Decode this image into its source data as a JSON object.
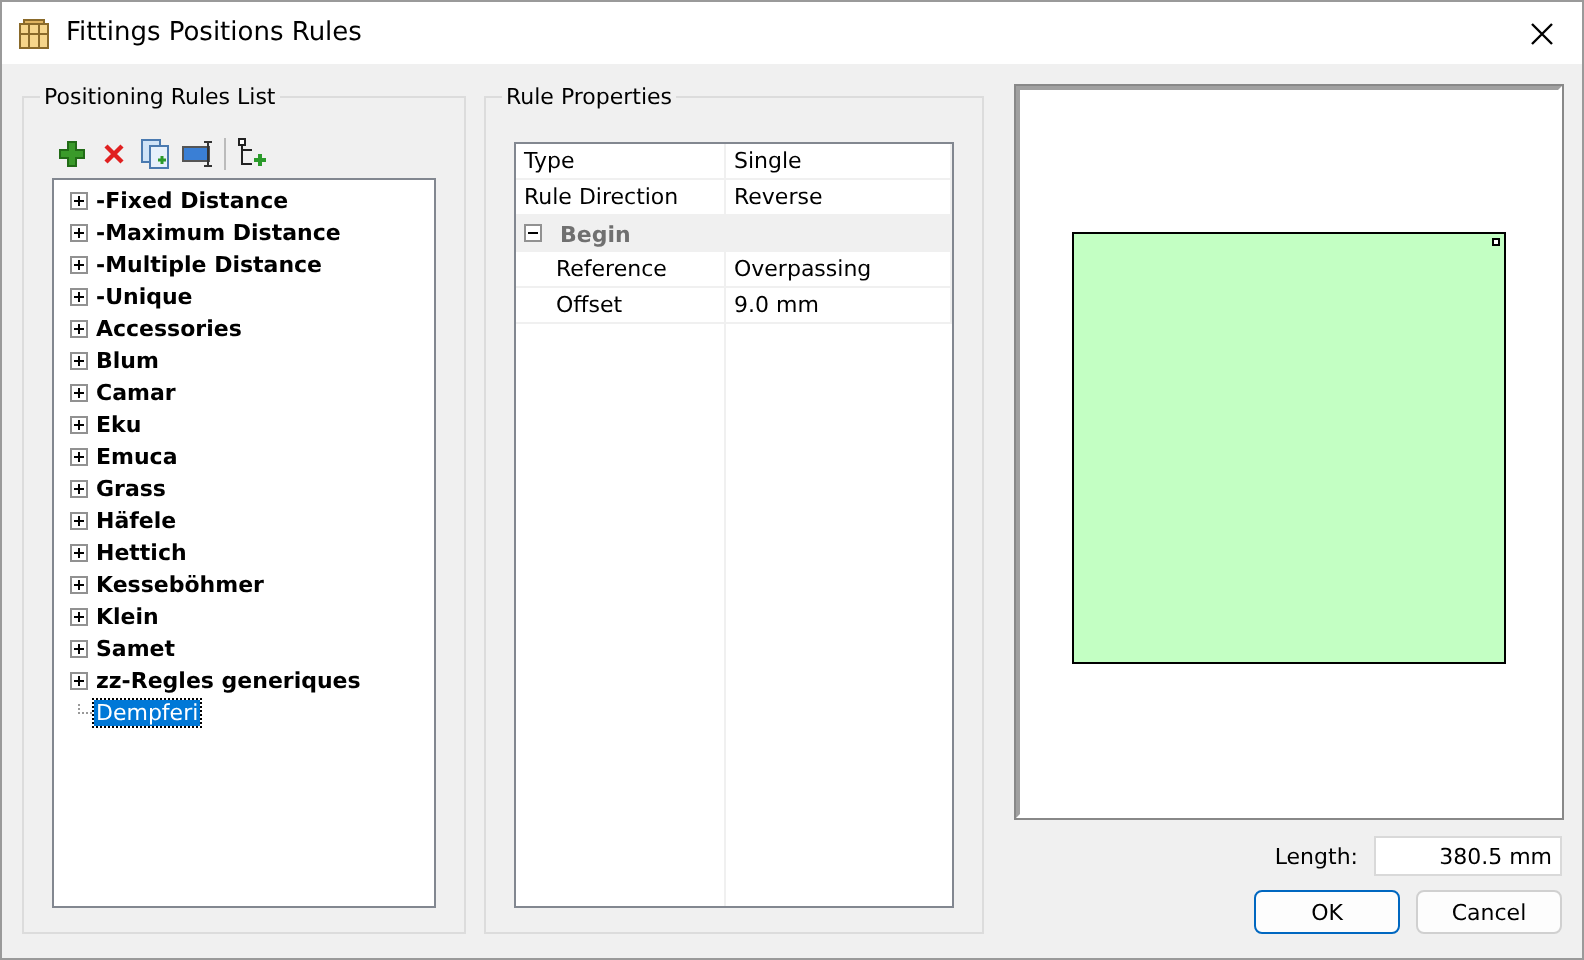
{
  "window": {
    "title": "Fittings Positions Rules"
  },
  "rules_list": {
    "title": "Positioning Rules List",
    "items": [
      {
        "label": "-Fixed Distance",
        "kind": "group",
        "selected": false
      },
      {
        "label": "-Maximum Distance",
        "kind": "group",
        "selected": false
      },
      {
        "label": "-Multiple Distance",
        "kind": "group",
        "selected": false
      },
      {
        "label": "-Unique",
        "kind": "group",
        "selected": false
      },
      {
        "label": "Accessories",
        "kind": "group",
        "selected": false
      },
      {
        "label": "Blum",
        "kind": "group",
        "selected": false
      },
      {
        "label": "Camar",
        "kind": "group",
        "selected": false
      },
      {
        "label": "Eku",
        "kind": "group",
        "selected": false
      },
      {
        "label": "Emuca",
        "kind": "group",
        "selected": false
      },
      {
        "label": "Grass",
        "kind": "group",
        "selected": false
      },
      {
        "label": "Häfele",
        "kind": "group",
        "selected": false
      },
      {
        "label": "Hettich",
        "kind": "group",
        "selected": false
      },
      {
        "label": "Kesseböhmer",
        "kind": "group",
        "selected": false
      },
      {
        "label": "Klein",
        "kind": "group",
        "selected": false
      },
      {
        "label": "Samet",
        "kind": "group",
        "selected": false
      },
      {
        "label": "zz-Regles generiques",
        "kind": "group",
        "selected": false
      },
      {
        "label": "Dempferi",
        "kind": "rule",
        "selected": true
      }
    ]
  },
  "rule_properties": {
    "title": "Rule Properties",
    "rows": [
      {
        "kind": "property",
        "name": "Type",
        "value": "Single"
      },
      {
        "kind": "property",
        "name": "Rule Direction",
        "value": "Reverse"
      },
      {
        "kind": "category",
        "name": "Begin",
        "expanded": true,
        "children": [
          {
            "kind": "property",
            "name": "Reference",
            "value": "Overpassing"
          },
          {
            "kind": "property",
            "name": "Offset",
            "value": "9.0 mm"
          }
        ]
      }
    ]
  },
  "length": {
    "label": "Length:",
    "value": "380.5 mm"
  },
  "buttons": [
    {
      "label": "OK",
      "default": true
    },
    {
      "label": "Cancel",
      "default": false
    }
  ]
}
